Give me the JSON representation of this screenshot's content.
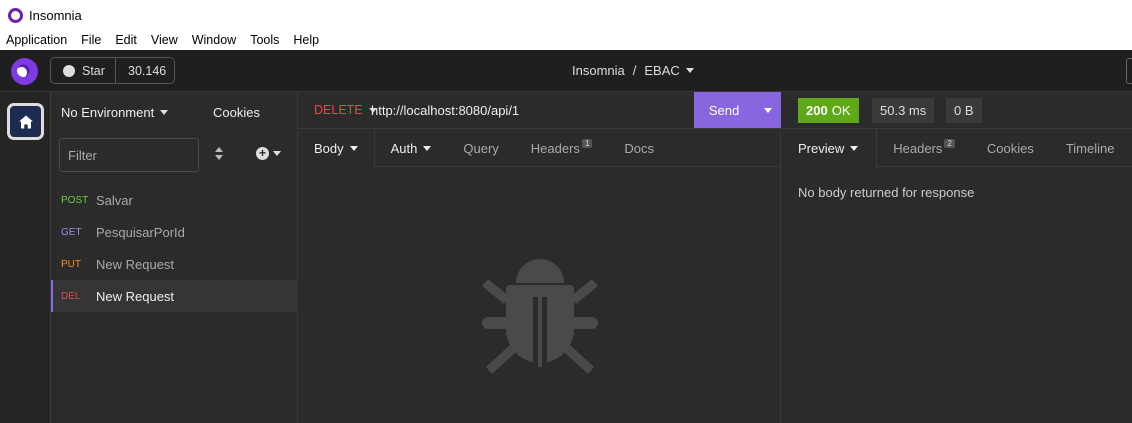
{
  "window": {
    "title": "Insomnia",
    "menu": [
      "Application",
      "File",
      "Edit",
      "View",
      "Window",
      "Tools",
      "Help"
    ]
  },
  "header": {
    "star_label": "Star",
    "star_count": "30.146",
    "breadcrumb_app": "Insomnia",
    "breadcrumb_sep": "/",
    "breadcrumb_project": "EBAC"
  },
  "sidebar": {
    "environment": "No Environment",
    "cookies": "Cookies",
    "filter_placeholder": "Filter",
    "requests": [
      {
        "method": "POST",
        "name": "Salvar",
        "color": "#6fcf3c"
      },
      {
        "method": "GET",
        "name": "PesquisarPorId",
        "color": "#9f8cf0"
      },
      {
        "method": "PUT",
        "name": "New Request",
        "color": "#f0922b"
      },
      {
        "method": "DEL",
        "name": "New Request",
        "color": "#e5484d"
      }
    ]
  },
  "request": {
    "method": "DELETE",
    "url": "http://localhost:8080/api/1",
    "send_label": "Send",
    "tabs": {
      "body": "Body",
      "auth": "Auth",
      "query": "Query",
      "headers": "Headers",
      "headers_count": "1",
      "docs": "Docs"
    }
  },
  "response": {
    "status_code": "200",
    "status_text": "OK",
    "time": "50.3 ms",
    "size": "0 B",
    "tabs": {
      "preview": "Preview",
      "headers": "Headers",
      "headers_count": "2",
      "cookies": "Cookies",
      "timeline": "Timeline"
    },
    "empty_message": "No body returned for response"
  },
  "colors": {
    "accent": "#8866e0",
    "status_ok": "#5fa818",
    "delete_method": "#e5484d"
  }
}
